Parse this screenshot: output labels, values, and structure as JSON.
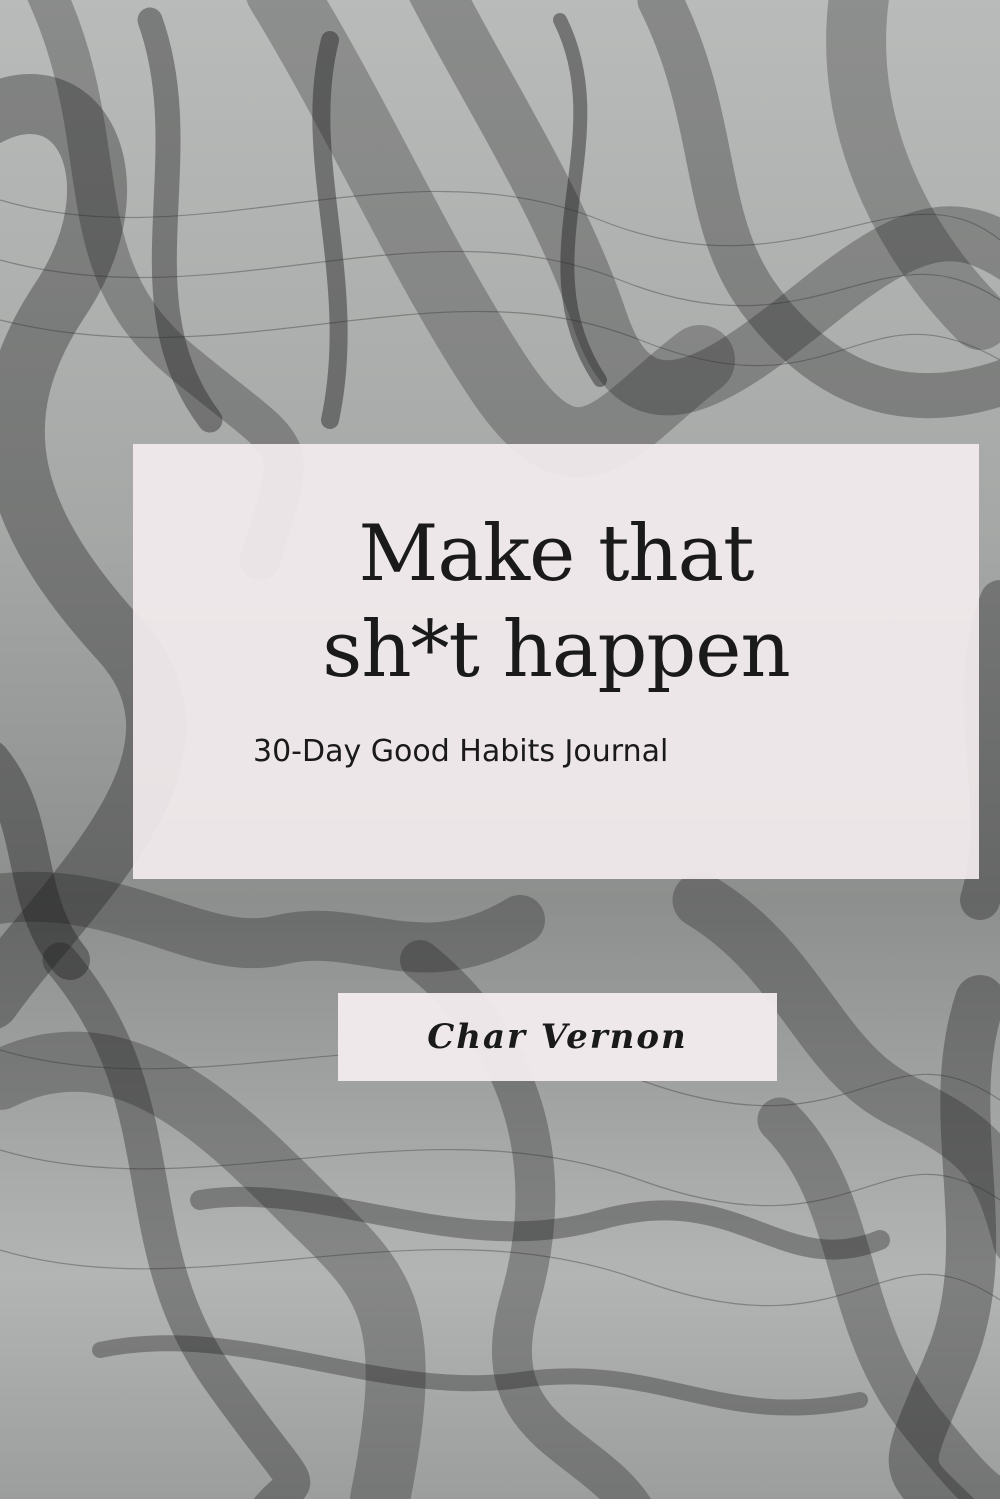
{
  "cover": {
    "title_line1": "Make that",
    "title_line2": "sh*t happen",
    "subtitle": "30-Day Good Habits Journal",
    "author": "Char Vernon"
  },
  "colors": {
    "background_gray": "#a6a8a7",
    "smoke_dark": "#1e1e1e",
    "panel_pink": "#f3ecee",
    "text": "#1a1a1a"
  }
}
